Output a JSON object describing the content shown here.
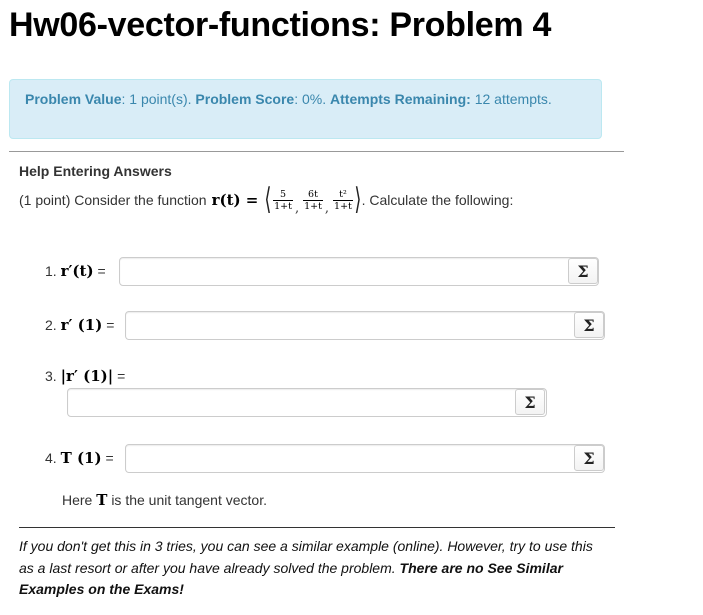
{
  "page_title": "Hw06-vector-functions: Problem 4",
  "status": {
    "value_label": "Problem Value",
    "value_text": ": 1 point(s).",
    "score_label": "Problem Score",
    "score_text": ": 0%.",
    "attempts_label": "Attempts Remaining:",
    "attempts_text": "12 attempts."
  },
  "help_link": "Help Entering Answers",
  "problem": {
    "prefix": "(1 point) Consider the function",
    "func_lhs": "r(t) =",
    "components": [
      {
        "num": "5",
        "den": "1+t"
      },
      {
        "num": "6t",
        "den": "1+t"
      },
      {
        "num": "t²",
        "den": "1+t"
      }
    ],
    "suffix": ". Calculate the following:"
  },
  "questions": [
    {
      "number": "1.",
      "expr": "r′(t)",
      "eq": "=",
      "value": ""
    },
    {
      "number": "2.",
      "expr": "r′ (1)",
      "eq": "=",
      "value": ""
    },
    {
      "number": "3.",
      "expr": "|r′ (1)|",
      "eq": "=",
      "value": ""
    },
    {
      "number": "4.",
      "expr": "T (1)",
      "eq": "=",
      "value": ""
    }
  ],
  "equation_button_label": "Σ",
  "note": {
    "prefix": "Here",
    "symbol": "T",
    "suffix": "is the unit tangent vector."
  },
  "footer": {
    "text": "If you don't get this in 3 tries, you can see a similar example (online). However, try to use this as a last resort or after you have already solved the problem.",
    "bold": "There are no See Similar Examples on the Exams!"
  },
  "colors": {
    "info_bg": "#d9edf7",
    "info_text": "#3a87ad",
    "info_border": "#bce8f1"
  }
}
